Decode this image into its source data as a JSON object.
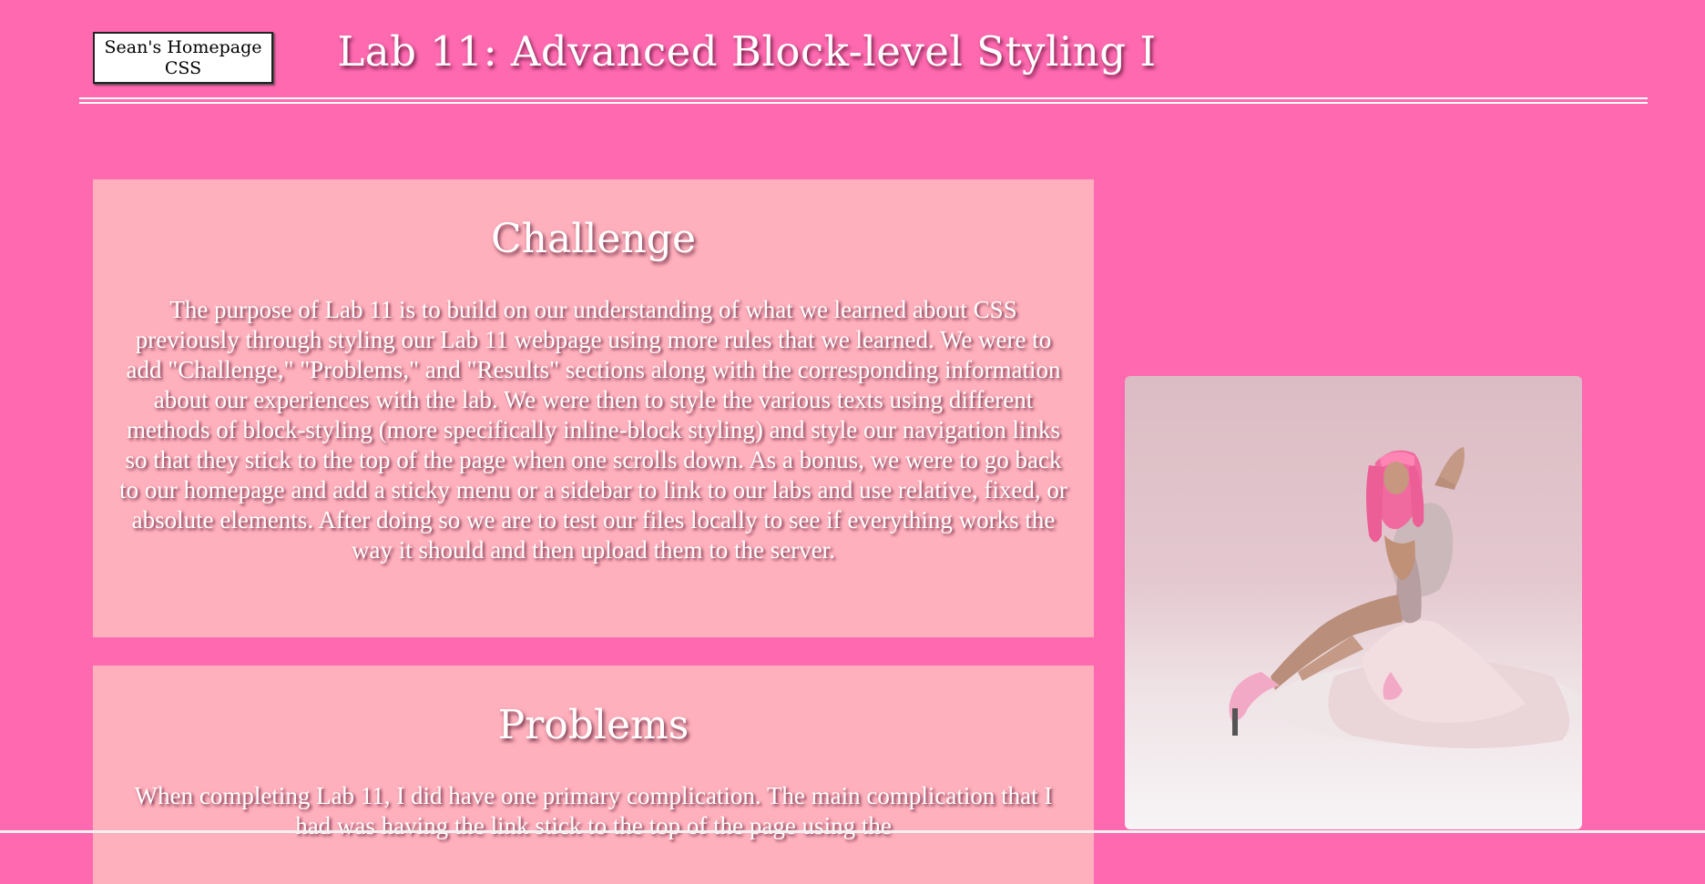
{
  "nav": {
    "home_link_line1": "Sean's Homepage",
    "home_link_line2": "CSS"
  },
  "header": {
    "title": "Lab 11: Advanced Block-level Styling I"
  },
  "sections": [
    {
      "heading": "Challenge",
      "body": "The purpose of  Lab 11 is to build on our understanding of  what we learned about CSS previously through styling our Lab 11 webpage using more rules that we learned. We were to add \"Challenge,\" \"Problems,\" and \"Results\" sections along with the corresponding information about our experiences with the lab. We were then to style the various texts using different methods of  block-styling (more specifically inline-block styling) and style our navigation links so that they stick to the top of the page when one scrolls down. As a bonus, we were to go back to our homepage and add a sticky menu or a sidebar to link to our labs and use relative, fixed, or absolute elements. After doing so we are to test our files locally to see if  everything works the way it should and then upload them to the server."
    },
    {
      "heading": "Problems",
      "body": "When completing Lab 11, I did have one primary complication. The main complication that I had was having the link stick to the top of  the page using the"
    }
  ],
  "colors": {
    "page_background": "#ff69b0",
    "section_background": "#ffb0bc",
    "text": "#ffffff"
  },
  "icons": {
    "photo": "photo-of-woman-in-pink-dress"
  }
}
